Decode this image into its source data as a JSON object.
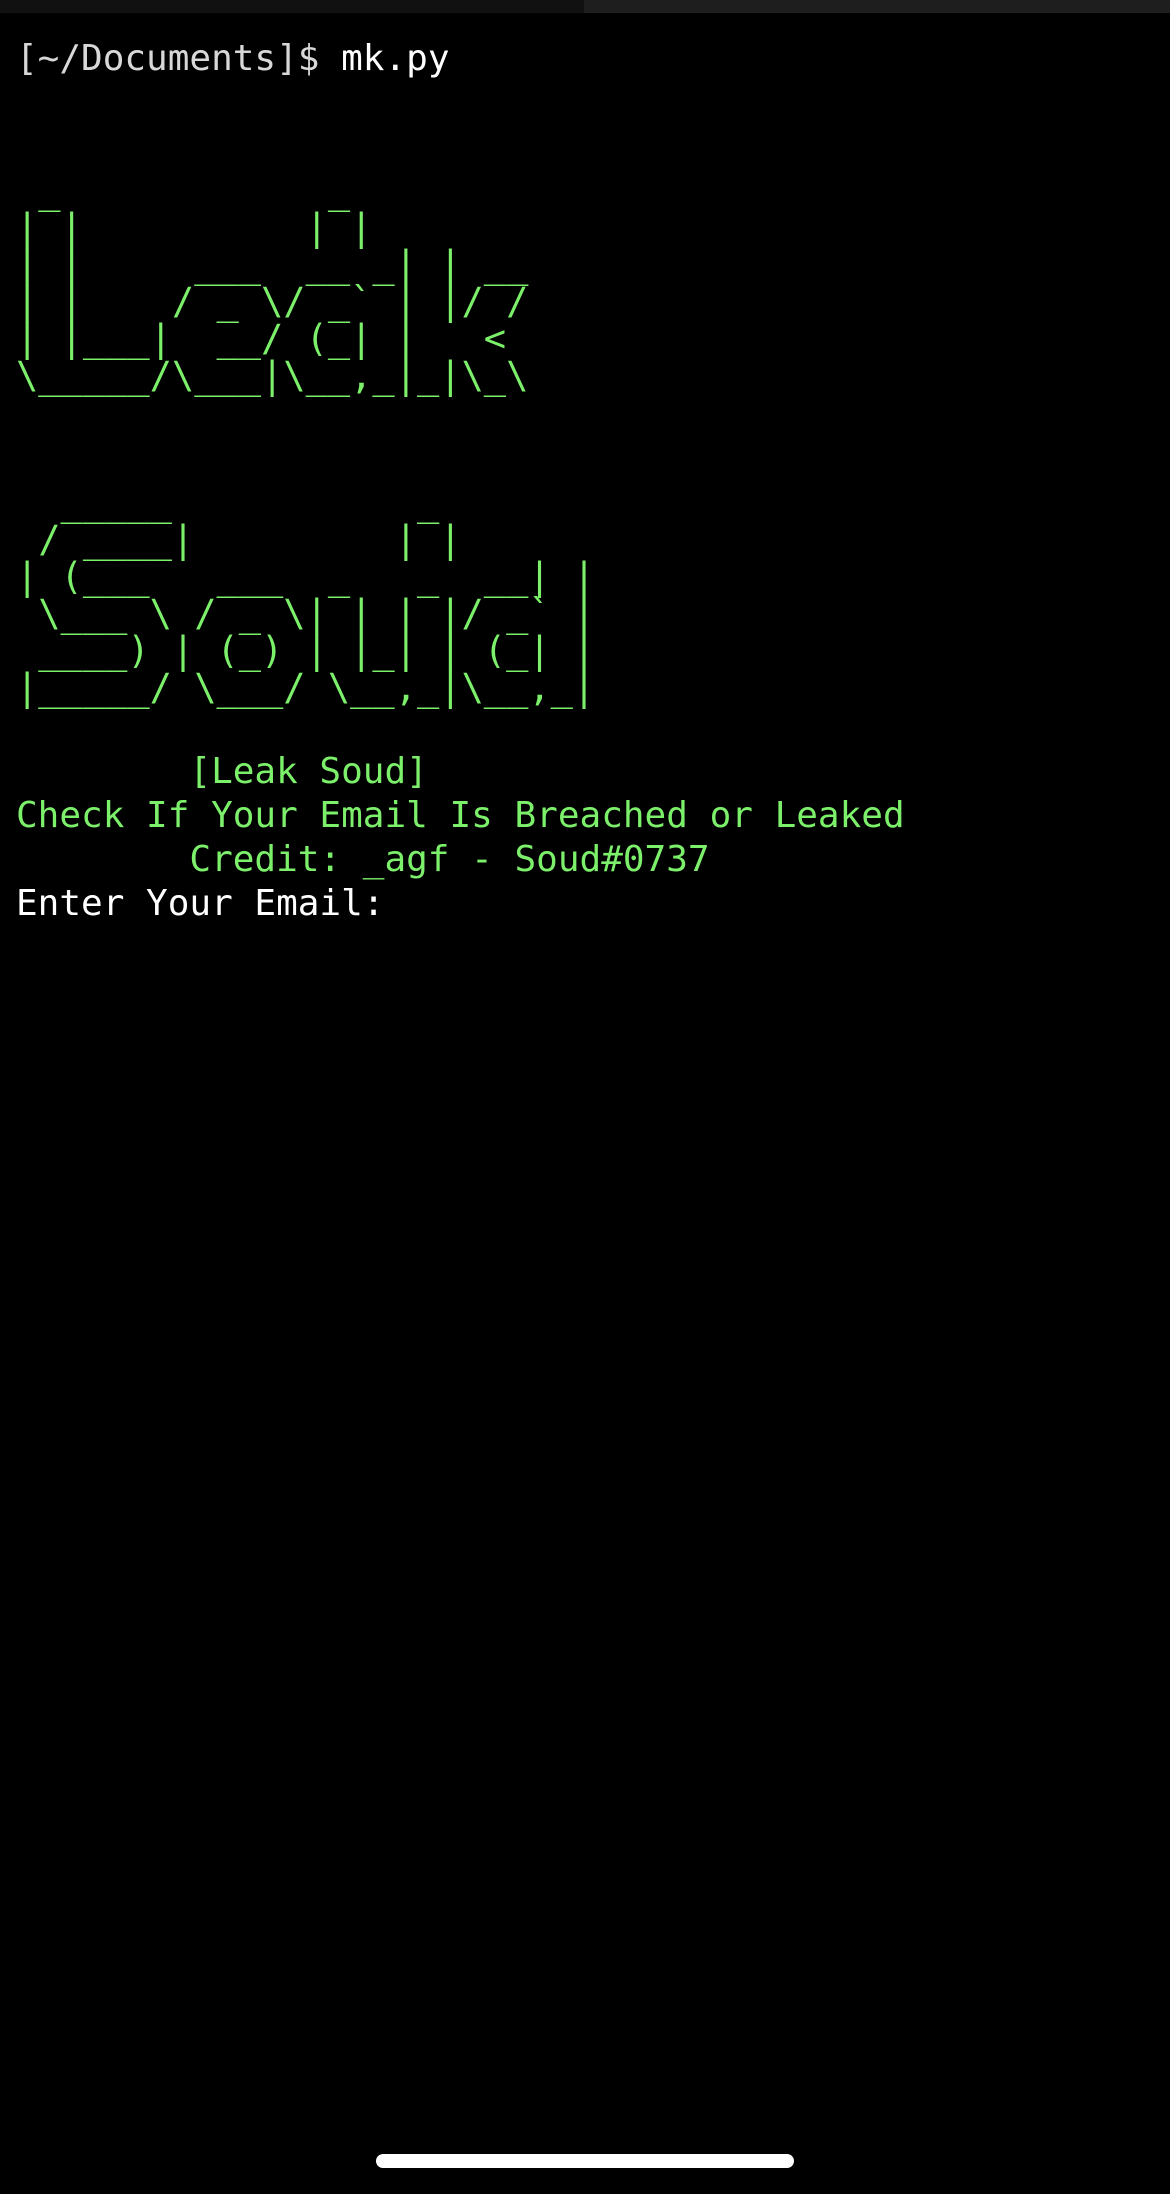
{
  "prompt": {
    "path": "[~/Documents]$",
    "command": "mk.py"
  },
  "banner": {
    "leak_ascii": " _            _    \n| |          | |   \n| |     ___  __ _| | __\n| |    / _ \\/ _` | |/ /\n| |___|  __/ (_| |   < \n\\_____/\\___|\\__,_|_|\\_\\",
    "soud_ascii": "  _____           _ \n / ____|         | |\n| (___   ___  _   _  __| |\n \\___ \\ / _ \\| | | |/ _` |\n ____) | (_) | |_| | (_| |\n|_____/ \\___/ \\__,_|\\__,_|"
  },
  "info": {
    "title": "        [Leak Soud]",
    "tagline": "Check If Your Email Is Breached or Leaked",
    "credit": "        Credit: _agf - Soud#0737"
  },
  "input": {
    "label": "Enter Your Email: ",
    "value": ""
  },
  "colors": {
    "background": "#000000",
    "accent_green": "#7cf06a",
    "text_white": "#ffffff"
  }
}
